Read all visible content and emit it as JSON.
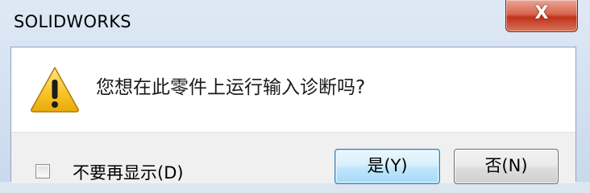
{
  "window": {
    "title": "SOLIDWORKS",
    "close_label": "X"
  },
  "dialog": {
    "icon": "warning-icon",
    "message": "您想在此零件上运行输入诊断吗?",
    "checkbox": {
      "label": "不要再显示(D)",
      "checked": false
    },
    "buttons": {
      "yes_label": "是(Y)",
      "no_label": "否(N)"
    }
  },
  "colors": {
    "close_button": "#c94a33",
    "default_button_border": "#3c7fb1",
    "warning_fill": "#f6c325"
  }
}
